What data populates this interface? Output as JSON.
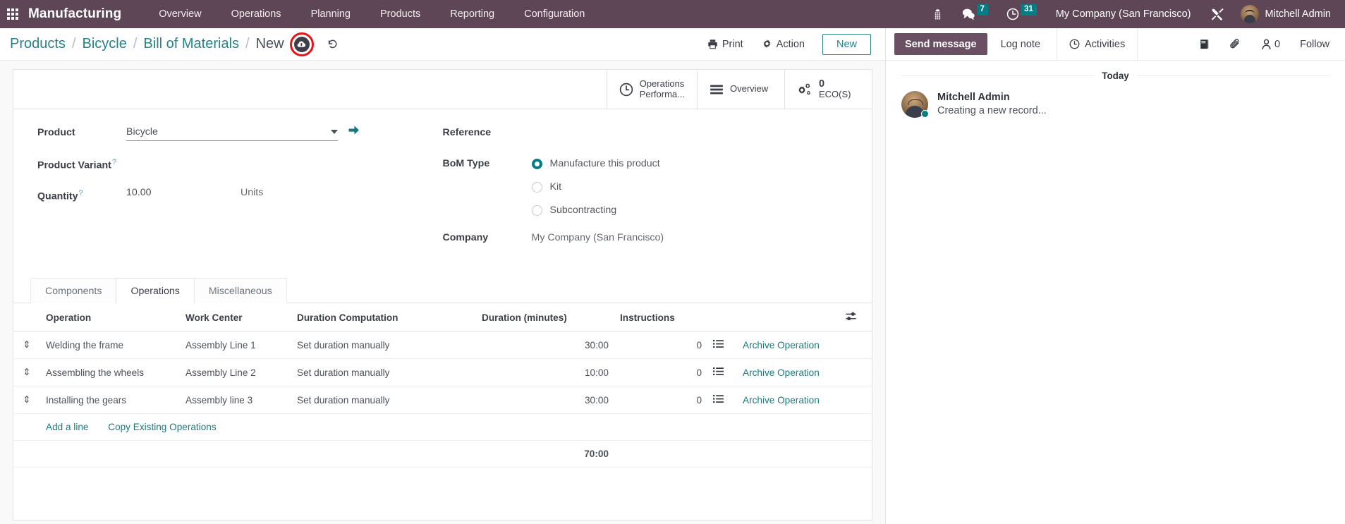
{
  "navbar": {
    "apps_icon": "apps-grid-icon",
    "app_title": "Manufacturing",
    "menu": [
      {
        "label": "Overview"
      },
      {
        "label": "Operations"
      },
      {
        "label": "Planning"
      },
      {
        "label": "Products"
      },
      {
        "label": "Reporting"
      },
      {
        "label": "Configuration"
      }
    ],
    "voip_icon": "phone-keypad-icon",
    "messages": {
      "icon": "chat-bubble-icon",
      "count": "7"
    },
    "activities": {
      "icon": "clock-icon",
      "count": "31"
    },
    "company": "My Company (San Francisco)",
    "debug_icon": "wrench-screwdriver-icon",
    "user": "Mitchell Admin"
  },
  "control_panel": {
    "breadcrumb": [
      {
        "label": "Products",
        "active": false
      },
      {
        "label": "Bicycle",
        "active": false
      },
      {
        "label": "Bill of Materials",
        "active": false
      },
      {
        "label": "New",
        "active": true
      }
    ],
    "separator": "/",
    "save_icon": "cloud-upload-save-icon",
    "discard_icon": "undo-discard-icon",
    "annotation": {
      "shape": "circle",
      "color": "#ee1111",
      "target": "save-button"
    },
    "print_label": "Print",
    "print_icon": "printer-icon",
    "action_label": "Action",
    "action_icon": "gear-icon",
    "new_label": "New"
  },
  "stat_buttons": [
    {
      "icon": "clock-icon",
      "line1": "Operations",
      "line2": "Performa..."
    },
    {
      "icon": "list-lines-icon",
      "line1": "Overview",
      "line2": ""
    },
    {
      "icon": "gears-icon",
      "value": "0",
      "label": "ECO(S)"
    }
  ],
  "form": {
    "left": {
      "product_label": "Product",
      "product_value": "Bicycle",
      "product_placeholder": "Bicycle",
      "dropdown_icon": "chevron-down-icon",
      "internal_link_icon": "arrow-right-icon",
      "product_variant_label": "Product Variant",
      "product_variant_value": "",
      "quantity_label": "Quantity",
      "quantity_value": "10.00",
      "quantity_uom": "Units",
      "help_marker": "?"
    },
    "right": {
      "reference_label": "Reference",
      "reference_value": "",
      "bom_type_label": "BoM Type",
      "bom_type_options": [
        {
          "label": "Manufacture this product",
          "selected": true
        },
        {
          "label": "Kit",
          "selected": false
        },
        {
          "label": "Subcontracting",
          "selected": false
        }
      ],
      "company_label": "Company",
      "company_value": "My Company (San Francisco)"
    }
  },
  "notebook": {
    "tabs": [
      {
        "label": "Components",
        "active": false
      },
      {
        "label": "Operations",
        "active": true
      },
      {
        "label": "Miscellaneous",
        "active": false
      }
    ],
    "columns": [
      "Operation",
      "Work Center",
      "Duration Computation",
      "Duration (minutes)",
      "Instructions"
    ],
    "optional_columns_icon": "sliders-icon",
    "drag_handle_icon": "drag-handle-icon",
    "instructions_icon": "list-icon",
    "rows": [
      {
        "operation": "Welding the frame",
        "work_center": "Assembly Line 1",
        "duration_computation": "Set duration manually",
        "duration": "30:00",
        "instructions": "0",
        "archive_label": "Archive Operation"
      },
      {
        "operation": "Assembling the wheels",
        "work_center": "Assembly Line 2",
        "duration_computation": "Set duration manually",
        "duration": "10:00",
        "instructions": "0",
        "archive_label": "Archive Operation"
      },
      {
        "operation": "Installing the gears",
        "work_center": "Assembly line 3",
        "duration_computation": "Set duration manually",
        "duration": "30:00",
        "instructions": "0",
        "archive_label": "Archive Operation"
      }
    ],
    "add_a_line": "Add a line",
    "copy_existing": "Copy Existing Operations",
    "total_duration": "70:00"
  },
  "chatter": {
    "send_message": "Send message",
    "log_note": "Log note",
    "activities": "Activities",
    "activities_icon": "clock-icon",
    "attachment_icon": "paperclip-icon",
    "log_icon": "book-icon",
    "followers_icon": "person-icon",
    "followers_count": "0",
    "follow_label": "Follow",
    "day_separator": "Today",
    "messages": [
      {
        "author": "Mitchell Admin",
        "body": "Creating a new record...",
        "avatar": "user-avatar"
      }
    ]
  },
  "colors": {
    "brand_purple": "#5f4657",
    "accent_teal": "#017e84",
    "link_teal": "#1b7a7f",
    "annotation_red": "#ee1111"
  }
}
